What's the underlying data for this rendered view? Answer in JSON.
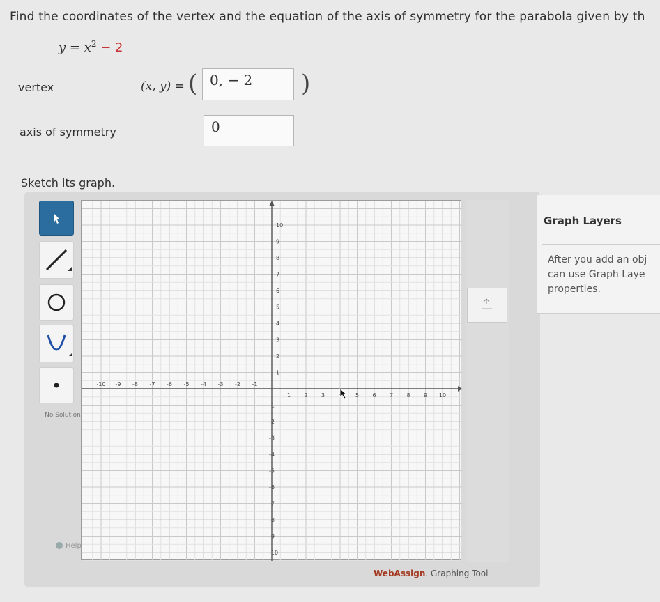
{
  "question": {
    "prompt": "Find the coordinates of the vertex and the equation of the axis of symmetry for the parabola given by th",
    "equation_lhs": "y = x",
    "equation_exp": "2",
    "equation_rest": " − 2"
  },
  "vertex": {
    "label": "vertex",
    "xy_label": "(x, y) =",
    "open_paren": "(",
    "close_paren": ")",
    "value": "0, − 2"
  },
  "axis_of_symmetry": {
    "label": "axis of symmetry",
    "value": "0"
  },
  "sketch": {
    "label": "Sketch its graph."
  },
  "tools": {
    "no_solution": "No Solution",
    "help": "Help"
  },
  "graph": {
    "x_ticks": [
      "-10",
      "-9",
      "-8",
      "-7",
      "-6",
      "-5",
      "-4",
      "-3",
      "-2",
      "-1",
      "1",
      "2",
      "3",
      "4",
      "5",
      "6",
      "7",
      "8",
      "9",
      "10"
    ],
    "y_ticks": [
      "10",
      "9",
      "8",
      "7",
      "6",
      "5",
      "4",
      "3",
      "2",
      "1",
      "-1",
      "-2",
      "-3",
      "-4",
      "-5",
      "-6",
      "-7",
      "-8",
      "-9",
      "-10"
    ],
    "xlim": [
      -10,
      10
    ],
    "ylim": [
      -10,
      10
    ]
  },
  "layers": {
    "title": "Graph Layers",
    "line1": "After you add an obj",
    "line2": "can use Graph Laye",
    "line3": "properties."
  },
  "brand": {
    "name": "WebAssign",
    "suffix": ". Graphing Tool"
  }
}
